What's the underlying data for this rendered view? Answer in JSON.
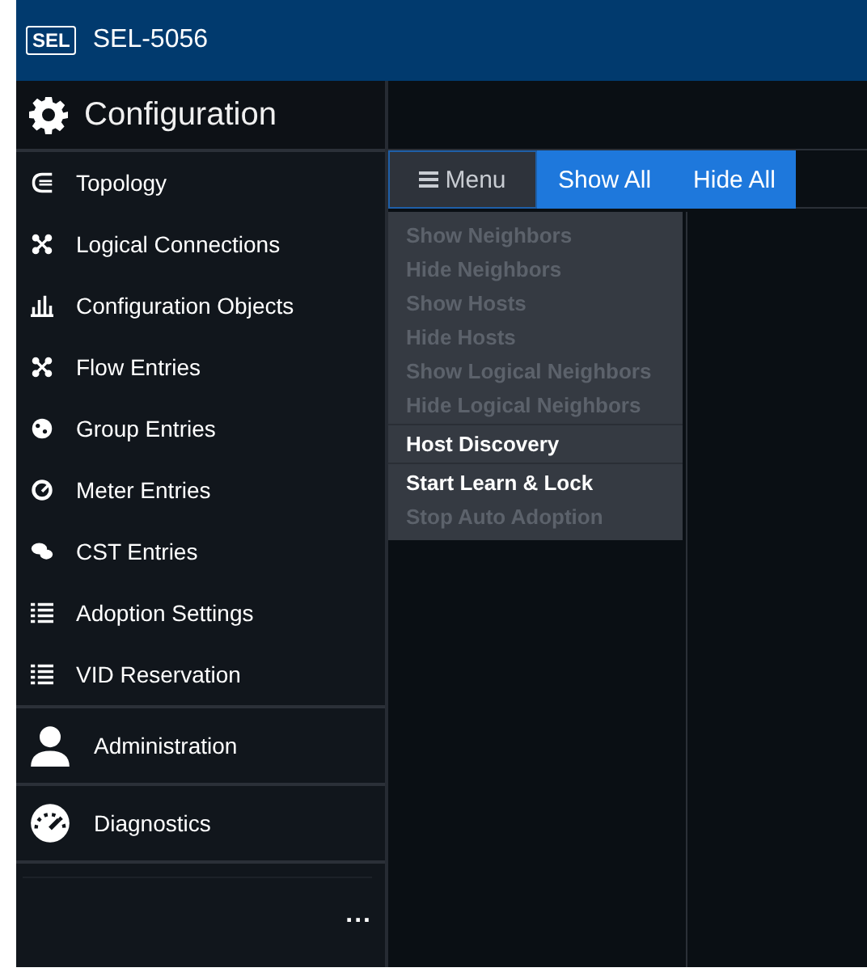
{
  "header": {
    "logo": "SEL",
    "title": "SEL-5056"
  },
  "sidebar": {
    "sections": [
      {
        "label": "Configuration",
        "items": [
          {
            "label": "Topology",
            "selected": false
          },
          {
            "label": "Logical Connections",
            "selected": false
          },
          {
            "label": "Configuration Objects",
            "selected": false
          },
          {
            "label": "Flow Entries",
            "selected": false
          },
          {
            "label": "Group Entries",
            "selected": false
          },
          {
            "label": "Meter Entries",
            "selected": false
          },
          {
            "label": "CST Entries",
            "selected": false
          },
          {
            "label": "Adoption Settings",
            "selected": false
          },
          {
            "label": "VID Reservation",
            "selected": false
          }
        ]
      },
      {
        "label": "Administration"
      },
      {
        "label": "Diagnostics"
      }
    ],
    "more": "..."
  },
  "toolbar": {
    "menu_button": "Menu",
    "buttons": [
      "Show All",
      "Hide All"
    ]
  },
  "menu": {
    "items": [
      {
        "label": "Show Neighbors",
        "disabled": true,
        "divider_above": false
      },
      {
        "label": "Hide Neighbors",
        "disabled": true,
        "divider_above": false
      },
      {
        "label": "Show Hosts",
        "disabled": true,
        "divider_above": false
      },
      {
        "label": "Hide Hosts",
        "disabled": true,
        "divider_above": false
      },
      {
        "label": "Show Logical Neighbors",
        "disabled": true,
        "divider_above": false
      },
      {
        "label": "Hide Logical Neighbors",
        "disabled": true,
        "divider_above": false
      },
      {
        "label": "Host Discovery",
        "disabled": false,
        "divider_above": true
      },
      {
        "label": "Start Learn & Lock",
        "disabled": false,
        "divider_above": true
      },
      {
        "label": "Stop Auto Adoption",
        "disabled": true,
        "divider_above": false
      }
    ]
  }
}
